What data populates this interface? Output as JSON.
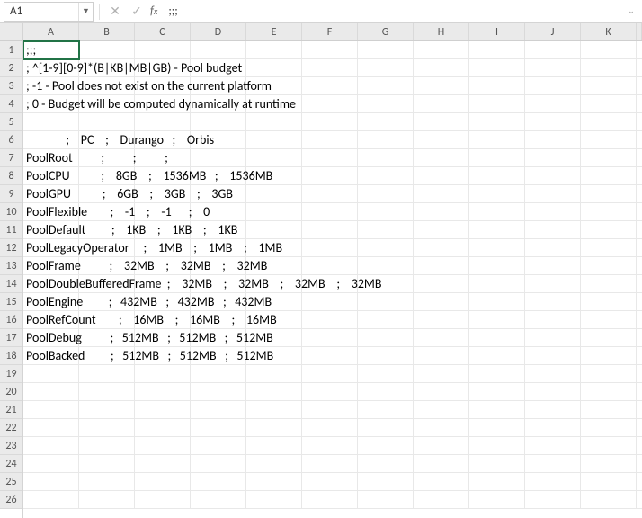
{
  "toolbar": {
    "cell_ref": "A1",
    "formula": ";;;"
  },
  "columns": [
    "A",
    "B",
    "C",
    "D",
    "E",
    "F",
    "G",
    "H",
    "I",
    "J",
    "K"
  ],
  "row_numbers": [
    "1",
    "2",
    "3",
    "4",
    "5",
    "6",
    "7",
    "8",
    "9",
    "10",
    "11",
    "12",
    "13",
    "14",
    "15",
    "16",
    "17",
    "18",
    "19",
    "20",
    "21",
    "22",
    "23",
    "24",
    "25",
    "26"
  ],
  "rows_text": [
    ";;;",
    "; ^[1-9][0-9]*(B|KB|MB|GB) - Pool budget",
    "; -1 - Pool does not exist on the current platform",
    "; 0 - Budget will be computed dynamically at runtime",
    "",
    "                         ;       PC      ;      Durango    ;      Orbis",
    "PoolRoot                  ;                 ;                 ;",
    "PoolCPU                   ;       8GB       ;       1536MB    ;       1536MB",
    "PoolGPU                   ;       6GB       ;       3GB       ;       3GB",
    "PoolFlexible              ;      -1       ;      -1          ;      0",
    "PoolDefault               ;       1KB       ;       1KB       ;       1KB",
    "PoolLegacyOperator        ;       1MB       ;       1MB       ;       1MB",
    "PoolFrame                 ;      32MB      ;      32MB      ;      32MB",
    "PoolDoubleBufferedFrame   ;      32MB      ;      32MB      ;      32MB      ;      32MB",
    "PoolEngine                ;     432MB     ;     432MB     ;     432MB",
    "PoolRefCount              ;      16MB      ;      16MB      ;      16MB",
    "PoolDebug                 ;     512MB     ;     512MB     ;     512MB",
    "PoolBacked                ;     512MB     ;     512MB     ;     512MB",
    "",
    "",
    "",
    "",
    "",
    "",
    "",
    ""
  ],
  "active_cell": {
    "row": 0,
    "col": 0
  }
}
